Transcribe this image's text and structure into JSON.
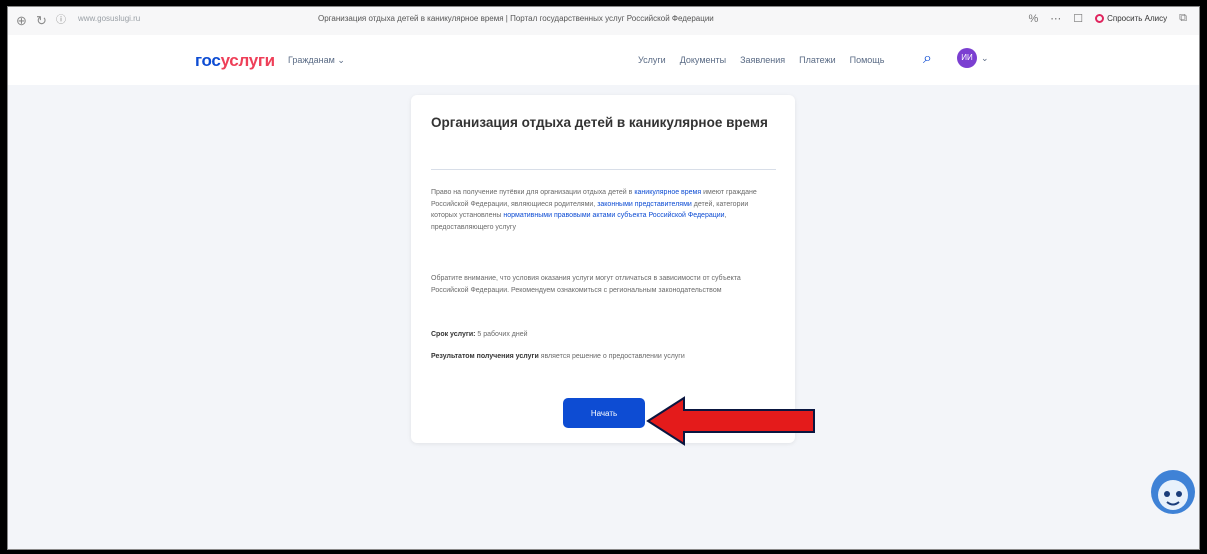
{
  "browser": {
    "url": "www.gosuslugi.ru",
    "tab_title": "Организация отдыха детей в каникулярное время | Портал государственных услуг Российской Федерации",
    "yandex_label": "Спросить Алису",
    "zoom": "%"
  },
  "header": {
    "logo_part1": "гос",
    "logo_part2": "услуги",
    "region": "Гражданам ⌄",
    "nav": [
      "Услуги",
      "Документы",
      "Заявления",
      "Платежи",
      "Помощь"
    ],
    "avatar_initials": "ИИ"
  },
  "card": {
    "title": "Организация отдыха детей в каникулярное время",
    "p1_a": "Право на получение путёвки для организации отдыха детей в ",
    "p1_link1": "каникулярное время",
    "p1_b": " имеют граждане Российской Федерации, являющиеся родителями, ",
    "p1_link2": "законными представителями",
    "p1_c": " детей, категории которых установлены ",
    "p1_link3": "нормативными правовыми актами субъекта Российской Федерации",
    "p1_d": ", предоставляющего услугу",
    "p2": "Обратите внимание, что условия оказания услуги могут отличаться в зависимости от субъекта Российской Федерации. Рекомендуем ознакомиться с региональным законодательством",
    "term_label": "Срок услуги:",
    "term_value": " 5 рабочих дней",
    "result_label": "Результатом получения услуги",
    "result_value": " является решение о предоставлении услуги",
    "button": "Начать"
  },
  "colors": {
    "primary": "#0d4cd3",
    "logo_accent": "#ee3f58",
    "arrow": "#e41b1b",
    "avatar": "#7b3fd1"
  }
}
